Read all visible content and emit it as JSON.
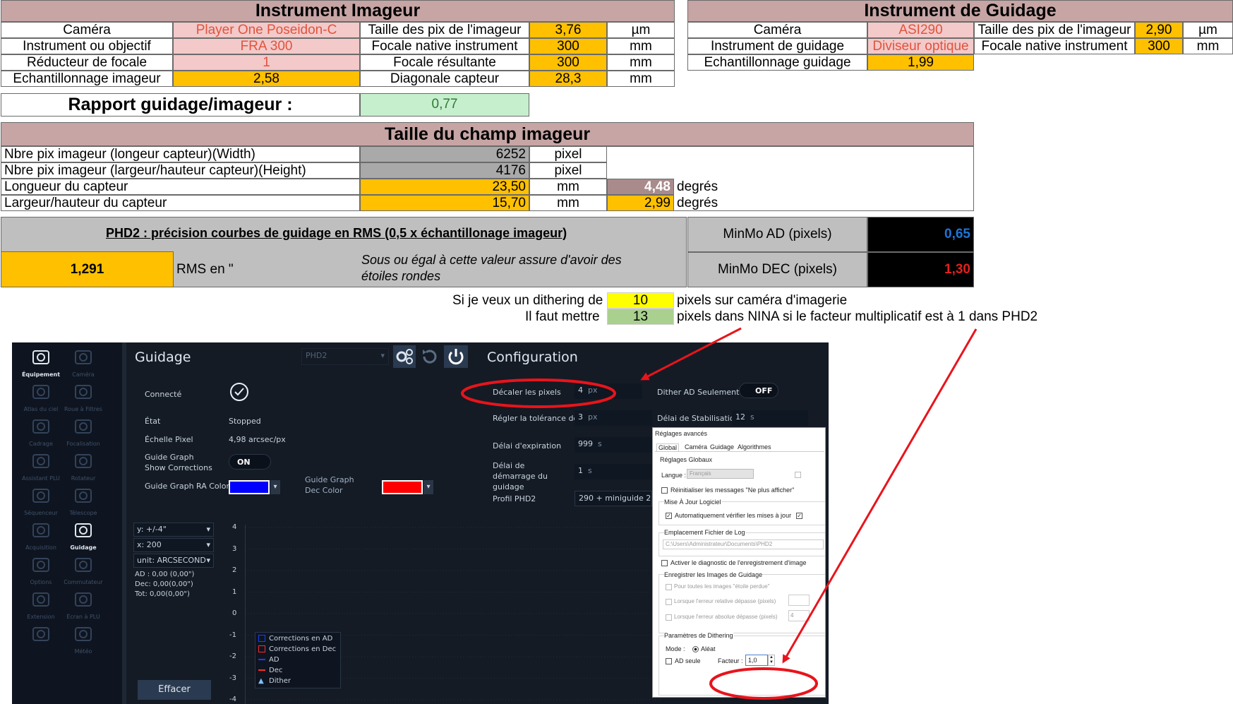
{
  "imageur": {
    "title": "Instrument Imageur",
    "rows": [
      {
        "label": "Caméra",
        "value": "Player One Poseidon-C",
        "label2": "Taille des pix de l'imageur",
        "value2": "3,76",
        "unit": "µm"
      },
      {
        "label": "Instrument ou objectif",
        "value": "FRA 300",
        "label2": "Focale native instrument",
        "value2": "300",
        "unit": "mm"
      },
      {
        "label": "Réducteur de focale",
        "value": "1",
        "label2": "Focale résultante",
        "value2": "300",
        "unit": "mm"
      },
      {
        "label": "Echantillonnage imageur",
        "value": "2,58",
        "label2": "Diagonale capteur",
        "value2": "28,3",
        "unit": "mm"
      }
    ]
  },
  "guidage": {
    "title": "Instrument de Guidage",
    "rows": [
      {
        "label": "Caméra",
        "value": "ASI290",
        "label2": "Taille des pix de l'imageur",
        "value2": "2,90",
        "unit": "µm"
      },
      {
        "label": "Instrument de guidage",
        "value": "Diviseur optique",
        "label2": "Focale native instrument",
        "value2": "300",
        "unit": "mm"
      },
      {
        "label": "Echantillonnage guidage",
        "value": "1,99"
      }
    ]
  },
  "rapport": {
    "label": "Rapport guidage/imageur :",
    "value": "0,77"
  },
  "champ": {
    "title": "Taille du champ imageur",
    "rows": [
      {
        "label": "Nbre pix imageur (longeur capteur)(Width)",
        "value": "6252",
        "unit": "pixel"
      },
      {
        "label": "Nbre pix imageur (largeur/hauteur capteur)(Height)",
        "value": "4176",
        "unit": "pixel"
      },
      {
        "label": "Longueur du capteur",
        "value": "23,50",
        "unit": "mm",
        "deg": "4,48",
        "deg_unit": "degrés"
      },
      {
        "label": "Largeur/hauteur du capteur",
        "value": "15,70",
        "unit": "mm",
        "deg": "2,99",
        "deg_unit": "degrés"
      }
    ]
  },
  "phd2": {
    "title": "PHD2 : précision courbes de guidage en RMS (0,5 x échantillonage imageur)",
    "rms_value": "1,291",
    "rms_label": "RMS en \"",
    "note": "Sous ou égal à cette valeur assure d'avoir des étoiles rondes",
    "minmo_ad_label": "MinMo AD (pixels)",
    "minmo_ad_value": "0,65",
    "minmo_dec_label": "MinMo DEC (pixels)",
    "minmo_dec_value": "1,30"
  },
  "dithering": {
    "line1_pre": "Si je veux un dithering de",
    "line1_value": "10",
    "line1_post": "pixels sur caméra d'imagerie",
    "line2_pre": "Il faut mettre",
    "line2_value": "13",
    "line2_post": "pixels dans NINA si le facteur multiplicatif est à 1 dans PHD2"
  },
  "nina": {
    "sidebar": [
      {
        "label": "Équipement",
        "icon": "equipment-icon",
        "active": true
      },
      {
        "label": "Caméra",
        "icon": "camera-icon"
      },
      {
        "label": "Atlas du ciel",
        "icon": "map-icon"
      },
      {
        "label": "Roue à Filtres",
        "icon": "filter-wheel-icon"
      },
      {
        "label": "Cadrage",
        "icon": "framing-icon"
      },
      {
        "label": "Focalisation",
        "icon": "focus-icon"
      },
      {
        "label": "Assistant PLU",
        "icon": "flat-wizard-icon"
      },
      {
        "label": "Rotateur",
        "icon": "rotator-icon"
      },
      {
        "label": "Séquenceur",
        "icon": "sequencer-icon"
      },
      {
        "label": "Télescope",
        "icon": "telescope-icon"
      },
      {
        "label": "Acquisition",
        "icon": "imaging-icon"
      },
      {
        "label": "Guidage",
        "icon": "guider-icon",
        "active": true
      },
      {
        "label": "Options",
        "icon": "gear-icon"
      },
      {
        "label": "Commutateur",
        "icon": "switch-icon"
      },
      {
        "label": "Extension",
        "icon": "plugin-icon"
      },
      {
        "label": "Écran à PLU",
        "icon": "flat-panel-icon"
      },
      {
        "label": "",
        "icon": "power-icon"
      },
      {
        "label": "Météo",
        "icon": "weather-icon"
      }
    ],
    "panel_title": "Guidage",
    "device": "PHD2",
    "config_title": "Configuration",
    "connecte_label": "Connecté",
    "etat_label": "État",
    "etat_value": "Stopped",
    "echelle_label": "Échelle Pixel",
    "echelle_value": "4,98 arcsec/px",
    "show_corr_label": "Guide Graph Show Corrections",
    "show_corr_value": "ON",
    "ra_color_label": "Guide Graph RA Color",
    "dec_color_label": "Guide Graph Dec Color",
    "ra_color": "#0000ff",
    "dec_color": "#ff0000",
    "graph_y": "y: +/-4\"",
    "graph_x": "x: 200",
    "graph_unit": "unit: ARCSECOND",
    "stats": [
      "AD : 0,00 (0,00\")",
      "Dec: 0,00(0,00\")",
      "Tot: 0,00(0,00\")"
    ],
    "y_ticks": [
      "4",
      "3",
      "2",
      "1",
      "0",
      "-1",
      "-2",
      "-3",
      "-4"
    ],
    "legend": [
      "Corrections en AD",
      "Corrections en Dec",
      "AD",
      "Dec",
      "Dither"
    ],
    "clear_button": "Effacer",
    "decaler_label": "Décaler les pixels",
    "decaler_value": "4",
    "decaler_unit": "px",
    "dither_ad_label": "Dither AD Seulement",
    "dither_ad_value": "OFF",
    "tolerance_label": "Régler la tolérance de",
    "tolerance_value": "3",
    "tolerance_unit": "px",
    "stabilisation_label": "Délai de Stabilisation !",
    "stabilisation_value": "12",
    "stabilisation_unit": "s",
    "expiration_label": "Délai d'expiration",
    "expiration_value": "999",
    "expiration_unit": "s",
    "demarrage_label": "Délai de démarrage du guidage",
    "demarrage_value": "1",
    "demarrage_unit": "s",
    "profil_label": "Profil PHD2",
    "profil_value": "290 + miniguide 2"
  },
  "dialog": {
    "title": "Réglages avancés",
    "tabs": [
      "Global",
      "Caméra",
      "Guidage",
      "Algorithmes"
    ],
    "group_global": "Réglages Globaux",
    "langue_label": "Langue :",
    "langue_value": "Français",
    "reset_msgs": "Réinitialiser les messages \"Ne plus afficher\"",
    "maj_group": "Mise À Jour Logiciel",
    "auto_check": "Automatiquement vérifier les mises à jour",
    "log_group": "Emplacement Fichier de Log",
    "log_path": "C:\\Users\\Administrateur\\Documents\\PHD2",
    "diag": "Activer le diagnostic de l'enregistrement d'image",
    "save_group": "Enregistrer les Images de Guidage",
    "opt1": "Pour toutes les images \"étoile perdue\"",
    "opt2": "Lorsque l'erreur relative dépasse (pixels)",
    "opt3": "Lorsque l'erreur absolue dépasse (pixels)",
    "opt3_value": "4",
    "dither_group": "Paramètres de Dithering",
    "mode_label": "Mode :",
    "mode_value": "Aléat",
    "ad_seule": "AD seule",
    "facteur_label": "Facteur :",
    "facteur_value": "1,0"
  },
  "colors": {
    "header": "#c7a5a5",
    "orange": "#ffc000",
    "annotation": "#e8141c"
  }
}
